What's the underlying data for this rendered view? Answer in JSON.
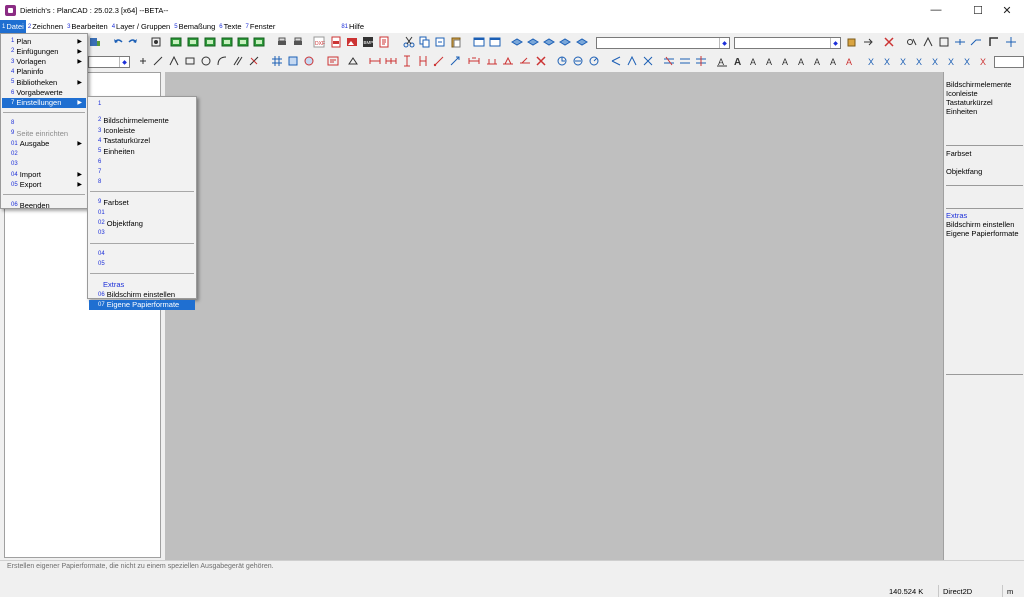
{
  "window": {
    "title": "Dietrich's : PlanCAD : 25.02.3 [x64] --BETA--",
    "minimize": "—",
    "maximize": "☐",
    "close": "✕"
  },
  "menubar": [
    {
      "num": "1",
      "label": "Datei",
      "active": true
    },
    {
      "num": "2",
      "label": "Zeichnen"
    },
    {
      "num": "3",
      "label": "Bearbeiten"
    },
    {
      "num": "4",
      "label": "Layer / Gruppen"
    },
    {
      "num": "5",
      "label": "Bemaßung"
    },
    {
      "num": "6",
      "label": "Texte"
    },
    {
      "num": "7",
      "label": "Fenster"
    },
    {
      "num": "81",
      "label": "Hilfe"
    }
  ],
  "file_menu": [
    {
      "num": "1",
      "label": "Plan",
      "submenu": true
    },
    {
      "num": "2",
      "label": "Einfügungen",
      "submenu": true
    },
    {
      "num": "3",
      "label": "Vorlagen",
      "submenu": true
    },
    {
      "num": "4",
      "label": "Planinfo"
    },
    {
      "num": "5",
      "label": "Bibliotheken",
      "submenu": true
    },
    {
      "num": "6",
      "label": "Vorgabewerte"
    },
    {
      "num": "7",
      "label": "Einstellungen",
      "submenu": true,
      "highlighted": true
    },
    {
      "separator": true
    },
    {
      "num": "8",
      "label": ""
    },
    {
      "num": "9",
      "label": "Seite einrichten",
      "disabled": true
    },
    {
      "num": "01",
      "label": "Ausgabe",
      "submenu": true
    },
    {
      "num": "02",
      "label": ""
    },
    {
      "num": "03",
      "label": ""
    },
    {
      "num": "04",
      "label": "Import",
      "submenu": true
    },
    {
      "num": "05",
      "label": "Export",
      "submenu": true
    },
    {
      "separator": true
    },
    {
      "num": "06",
      "label": "Beenden"
    }
  ],
  "settings_submenu": [
    {
      "num": "1",
      "label": ""
    },
    {
      "gap": true
    },
    {
      "num": "2",
      "label": "Bildschirmelemente"
    },
    {
      "num": "3",
      "label": "Iconleiste"
    },
    {
      "num": "4",
      "label": "Tastaturkürzel"
    },
    {
      "num": "5",
      "label": "Einheiten"
    },
    {
      "num": "6",
      "label": ""
    },
    {
      "num": "7",
      "label": ""
    },
    {
      "num": "8",
      "label": ""
    },
    {
      "separator": true
    },
    {
      "num": "9",
      "label": "Farbset"
    },
    {
      "num": "01",
      "label": ""
    },
    {
      "num": "02",
      "label": "Objektfang"
    },
    {
      "num": "03",
      "label": ""
    },
    {
      "separator": true
    },
    {
      "num": "04",
      "label": ""
    },
    {
      "num": "05",
      "label": ""
    },
    {
      "separator": true
    },
    {
      "num": "",
      "label": "Extras",
      "blue": true
    },
    {
      "num": "06",
      "label": "Bildschirm einstellen"
    },
    {
      "num": "07",
      "label": "Eigene Papierformate",
      "highlighted": true
    }
  ],
  "right_panel": {
    "group1": [
      "Bildschirmelemente",
      "Iconleiste",
      "Tastaturkürzel",
      "Einheiten"
    ],
    "group2a": "Farbset",
    "group2b": "Objektfang",
    "extras_title": "Extras",
    "group3": [
      "Bildschirm einstellen",
      "Eigene Papierformate"
    ]
  },
  "toolbar": {
    "combo1_value": "",
    "combo2_value": "",
    "combo3_value": "",
    "layer_combo_value": ""
  },
  "status": {
    "message": "Erstellen eigener Papierformate, die nicht zu einem speziellen Ausgabegerät gehören.",
    "memory": "140.524 K",
    "renderer": "Direct2D",
    "unit": "m"
  },
  "colors": {
    "highlight": "#1f6fd1",
    "menu_number": "#1c2fd9",
    "canvas": "#bfbfbf",
    "app_icon": "#8b2c84"
  }
}
